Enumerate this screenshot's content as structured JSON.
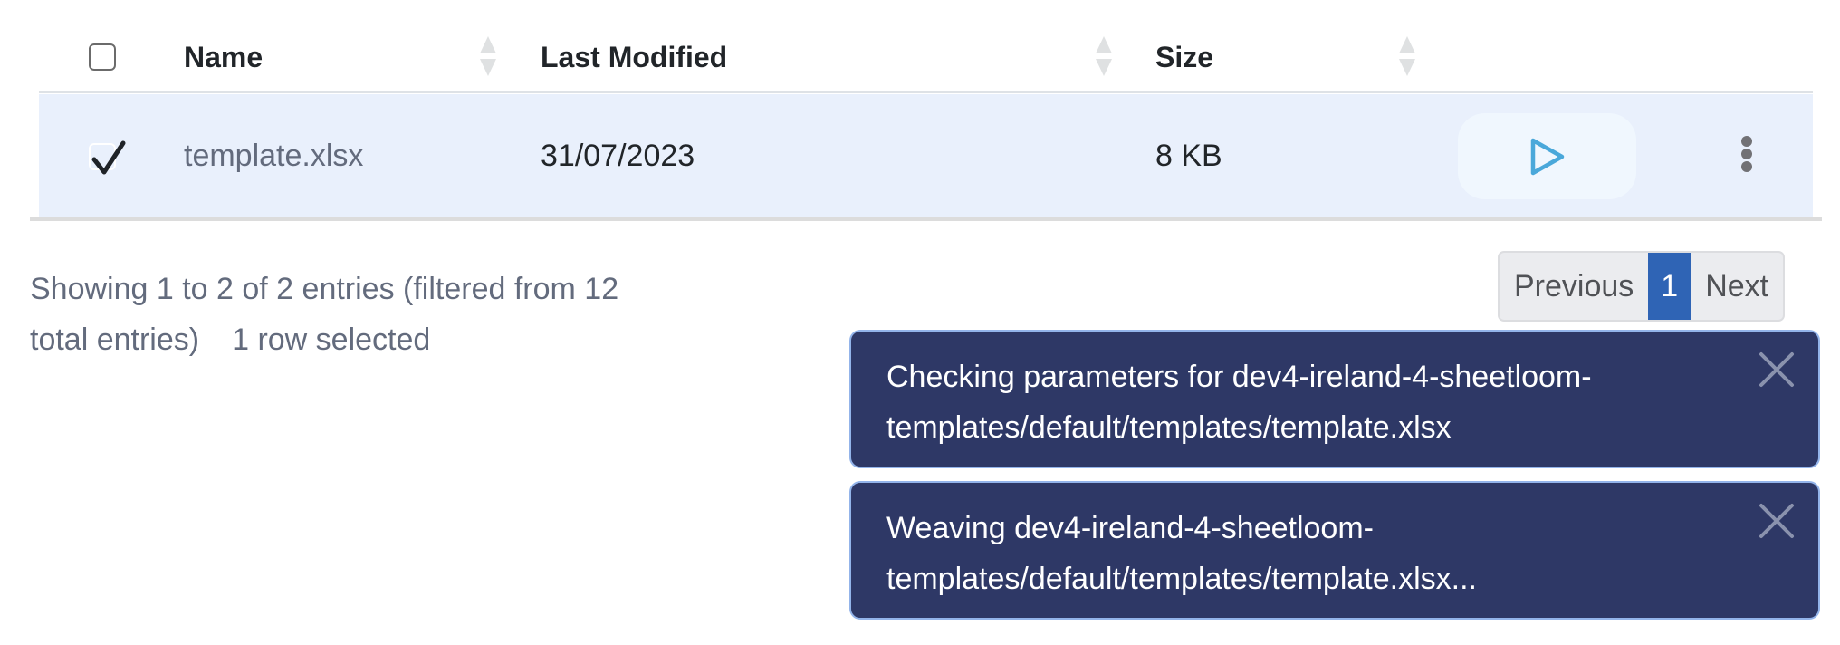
{
  "table": {
    "columns": [
      {
        "label": "Name",
        "sortable": true
      },
      {
        "label": "Last Modified",
        "sortable": true
      },
      {
        "label": "Size",
        "sortable": true
      },
      {
        "label": "",
        "sortable": true
      }
    ],
    "select_all_checked": false,
    "rows": [
      {
        "selected": true,
        "name": "template.xlsx",
        "last_modified": "31/07/2023",
        "size": "8 KB",
        "actions": {
          "run_icon": "play-icon",
          "menu_icon": "kebab-menu-icon"
        }
      }
    ]
  },
  "footer": {
    "info": "Showing 1 to 2 of 2 entries (filtered from 12 total entries)",
    "info_line1": "Showing 1 to 2 of 2 entries (filtered from 12",
    "info_line2": "total entries)",
    "selection": "1 row selected"
  },
  "pagination": {
    "previous_label": "Previous",
    "current_page": "1",
    "next_label": "Next"
  },
  "toasts": [
    {
      "message": "Checking parameters for dev4-ireland-4-sheetloom-templates/default/templates/template.xlsx",
      "line1": "Checking parameters for dev4-ireland-4-sheetloom-",
      "line2": "templates/default/templates/template.xlsx",
      "close_icon": "close-icon"
    },
    {
      "message": "Weaving dev4-ireland-4-sheetloom-templates/default/templates/template.xlsx...",
      "line1": "Weaving dev4-ireland-4-sheetloom-",
      "line2": "templates/default/templates/template.xlsx...",
      "close_icon": "close-icon"
    }
  ],
  "colors": {
    "selected_row_bg": "#e9f0fc",
    "pagination_active": "#2f64b5",
    "toast_bg": "#2e3866",
    "toast_border": "#93b4ea",
    "play_icon": "#4aa8da"
  }
}
